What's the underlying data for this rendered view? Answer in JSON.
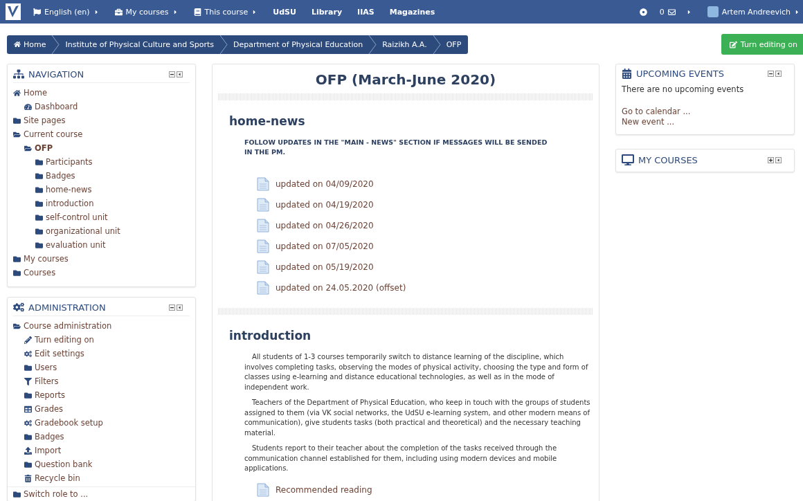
{
  "navbar": {
    "items": [
      {
        "label": "English (en)",
        "kind": "flag",
        "dropdown": true
      },
      {
        "label": "My courses",
        "kind": "briefcase",
        "dropdown": true
      },
      {
        "label": "This course",
        "kind": "book",
        "dropdown": true
      },
      {
        "label": "UdSU",
        "kind": "plain",
        "dropdown": false
      },
      {
        "label": "Library",
        "kind": "plain",
        "dropdown": false
      },
      {
        "label": "IIAS",
        "kind": "plain",
        "dropdown": false
      },
      {
        "label": "Magazines",
        "kind": "plain",
        "dropdown": false
      }
    ],
    "messages": {
      "count": "0",
      "dropdown": true
    },
    "user": {
      "name": "Artem Andreevich",
      "dropdown": true
    }
  },
  "breadcrumb": [
    {
      "label": "Home",
      "kind": "home"
    },
    {
      "label": "Institute of Physical Culture and Sports",
      "kind": "plain"
    },
    {
      "label": "Department of Physical Education",
      "kind": "plain"
    },
    {
      "label": "Raizikh A.A.",
      "kind": "plain"
    },
    {
      "label": "OFP",
      "kind": "plain"
    }
  ],
  "edit_button": {
    "label": "Turn editing on"
  },
  "navigation": {
    "title": "NAVIGATION",
    "expanded": true,
    "items": [
      {
        "label": "Home",
        "kind": "home",
        "selected": false,
        "children": [
          {
            "label": "Dashboard",
            "kind": "dashboard",
            "selected": false
          }
        ]
      },
      {
        "label": "Site pages",
        "kind": "folder",
        "selected": false
      },
      {
        "label": "Current course",
        "kind": "folder-open",
        "selected": false,
        "children": [
          {
            "label": "OFP",
            "kind": "folder-open",
            "selected": true,
            "children": [
              {
                "label": "Participants",
                "kind": "folder",
                "selected": false
              },
              {
                "label": "Badges",
                "kind": "folder",
                "selected": false
              },
              {
                "label": "home-news",
                "kind": "folder",
                "selected": false
              },
              {
                "label": "introduction",
                "kind": "folder",
                "selected": false
              },
              {
                "label": "self-control unit",
                "kind": "folder",
                "selected": false
              },
              {
                "label": "organizational unit",
                "kind": "folder",
                "selected": false
              },
              {
                "label": "evaluation unit",
                "kind": "folder",
                "selected": false
              }
            ]
          }
        ]
      },
      {
        "label": "My courses",
        "kind": "folder",
        "selected": false
      },
      {
        "label": "Courses",
        "kind": "folder",
        "selected": false
      }
    ]
  },
  "administration": {
    "title": "ADMINISTRATION",
    "expanded": true,
    "items": [
      {
        "label": "Course administration",
        "kind": "folder-open",
        "children": [
          {
            "label": "Turn editing on",
            "kind": "pencil"
          },
          {
            "label": "Edit settings",
            "kind": "gears"
          },
          {
            "label": "Users",
            "kind": "folder"
          },
          {
            "label": "Filters",
            "kind": "filter"
          },
          {
            "label": "Reports",
            "kind": "folder"
          },
          {
            "label": "Grades",
            "kind": "table"
          },
          {
            "label": "Gradebook setup",
            "kind": "gears"
          },
          {
            "label": "Badges",
            "kind": "folder"
          },
          {
            "label": "Import",
            "kind": "upload"
          },
          {
            "label": "Question bank",
            "kind": "folder"
          },
          {
            "label": "Recycle bin",
            "kind": "trash"
          }
        ]
      }
    ],
    "footer_item": {
      "label": "Switch role to ...",
      "kind": "folder"
    }
  },
  "course": {
    "title": "OFP (March-June 2020)",
    "sections": [
      {
        "title": "home-news",
        "summary": "FOLLOW UPDATES IN THE \"MAIN - NEWS\" SECTION IF MESSAGES WILL BE SENDED IN THE PM.",
        "activities": [
          "updated on 04/09/2020",
          "updated on 04/19/2020",
          "updated on 04/26/2020",
          "updated on 07/05/2020",
          "updated on 05/19/2020",
          "updated on 24.05.2020 (offset)"
        ]
      },
      {
        "title": "introduction",
        "paragraphs": [
          "All students of 1-3 courses temporarily switch to distance learning of the discipline, which involves completing tasks, observing the modes of physical activity, choosing the type and form of classes using e-learning and distance educational technologies, as well as in the mode of independent work.",
          "Teachers of the Department of Physical Education, who keep in touch with the groups of students assigned to them (via VK social networks, the UdSU e-learning system, and other modern means of communication), give students tasks (both practical and theoretical) and the necessary teaching material.",
          "Students report to their teacher about the completion of the tasks received through the communication channel established for them, including using modern devices and mobile applications."
        ],
        "activities": [
          "Recommended reading"
        ]
      }
    ]
  },
  "upcoming_events": {
    "title": "UPCOMING EVENTS",
    "expanded": true,
    "message": "There are no upcoming events",
    "links": [
      "Go to calendar ...",
      "New event ..."
    ]
  },
  "my_courses": {
    "title": "MY COURSES",
    "expanded": false
  }
}
